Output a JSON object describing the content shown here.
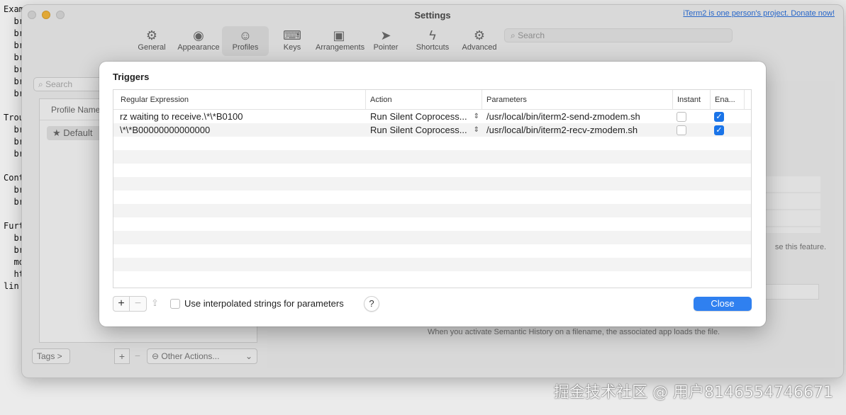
{
  "terminal_lines": [
    "Exam",
    "  br",
    "  br",
    "  br",
    "  br",
    "  br",
    "  br",
    "  br",
    "",
    "Trou",
    "  br",
    "  br",
    "  br",
    "",
    "Cont",
    "  br",
    "  br",
    "",
    "Furt",
    "  br",
    "  br",
    "  mo",
    "  ht",
    "lin"
  ],
  "window": {
    "title": "Settings",
    "donate_link": "iTerm2 is one person's project. Donate now!",
    "toolbar": [
      {
        "label": "General",
        "icon": "gear-icon",
        "glyph": "⚙"
      },
      {
        "label": "Appearance",
        "icon": "eye-icon",
        "glyph": "◉"
      },
      {
        "label": "Profiles",
        "icon": "person-icon",
        "glyph": "☺"
      },
      {
        "label": "Keys",
        "icon": "keyboard-icon",
        "glyph": "⌨"
      },
      {
        "label": "Arrangements",
        "icon": "windows-icon",
        "glyph": "▣"
      },
      {
        "label": "Pointer",
        "icon": "pointer-icon",
        "glyph": "➤"
      },
      {
        "label": "Shortcuts",
        "icon": "bolt-icon",
        "glyph": "ϟ"
      },
      {
        "label": "Advanced",
        "icon": "gears-icon",
        "glyph": "⚙"
      }
    ],
    "search_placeholder": "Search",
    "left_search_placeholder": "Search",
    "profile_header": "Profile Name",
    "default_profile": "★ Default",
    "tags_button": "Tags >",
    "other_actions": "⊖ Other Actions...",
    "right_text": "se this feature.",
    "semantic_note": "When you activate Semantic History on a filename, the associated app loads the file."
  },
  "triggers": {
    "title": "Triggers",
    "columns": [
      "Regular Expression",
      "Action",
      "Parameters",
      "Instant",
      "Ena..."
    ],
    "rows": [
      {
        "regex": "rz waiting to receive.\\*\\*B0100",
        "action": "Run Silent Coprocess...",
        "params": "/usr/local/bin/iterm2-send-zmodem.sh",
        "instant": false,
        "enabled": true
      },
      {
        "regex": "\\*\\*B00000000000000",
        "action": "Run Silent Coprocess...",
        "params": "/usr/local/bin/iterm2-recv-zmodem.sh",
        "instant": false,
        "enabled": true
      }
    ],
    "add_label": "+",
    "remove_label": "−",
    "interpolated_label": "Use interpolated strings for parameters",
    "help_label": "?",
    "close_label": "Close"
  },
  "watermark": "掘金技术社区 @ 用户8146554746671"
}
